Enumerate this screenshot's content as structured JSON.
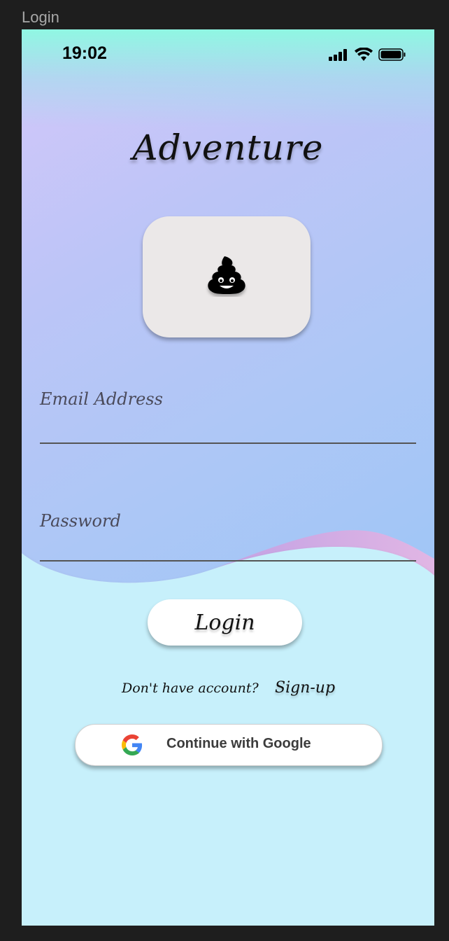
{
  "frame": {
    "label": "Login"
  },
  "status_bar": {
    "time": "19:02"
  },
  "app": {
    "title": "Adventure",
    "logo_icon": "pile-of-poo-icon"
  },
  "form": {
    "email_label": "Email Address",
    "email_value": "",
    "password_label": "Password",
    "password_value": ""
  },
  "actions": {
    "login_label": "Login",
    "no_account_text": "Don't have account?",
    "signup_label": "Sign-up",
    "google_label": "Continue with Google"
  },
  "colors": {
    "top_gradient_start": "#d4c6fa",
    "top_gradient_end": "#9fc6f6",
    "bottom_background": "#c7f0fb",
    "wave_accent": "#d4b0e8"
  }
}
